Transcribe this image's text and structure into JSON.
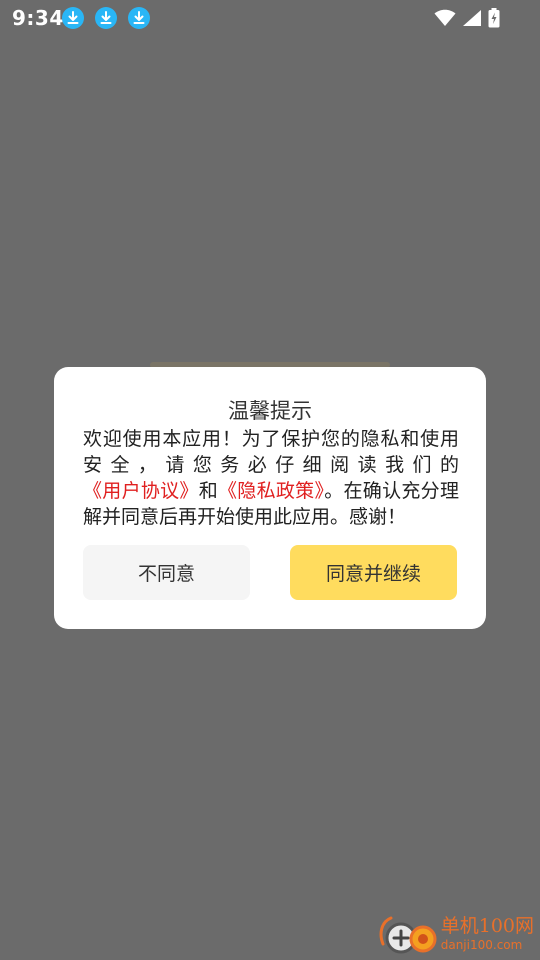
{
  "status_bar": {
    "time": "9:34",
    "download_icons": [
      "download-icon",
      "download-icon",
      "download-icon"
    ],
    "system_icons": [
      "wifi-icon",
      "cell-signal-icon",
      "battery-charging-icon"
    ]
  },
  "dialog": {
    "title": "温馨提示",
    "body_prefix": "欢迎使用本应用！为了保护您的隐私和使用安全，请您务必仔细阅读我们的",
    "user_agreement_link": "《用户协议》",
    "and_text": "和",
    "privacy_policy_link": "《隐私政策》",
    "body_suffix": "。在确认充分理解并同意后再开始使用此应用。感谢！",
    "disagree_label": "不同意",
    "agree_label": "同意并继续"
  },
  "watermark": {
    "name": "单机100网",
    "url": "danji100.com"
  },
  "colors": {
    "overlay": "#6b6b6b",
    "link": "#e02020",
    "agree_button": "#ffdc5e",
    "disagree_button": "#f5f5f5",
    "download_badge": "#29b6f6"
  }
}
